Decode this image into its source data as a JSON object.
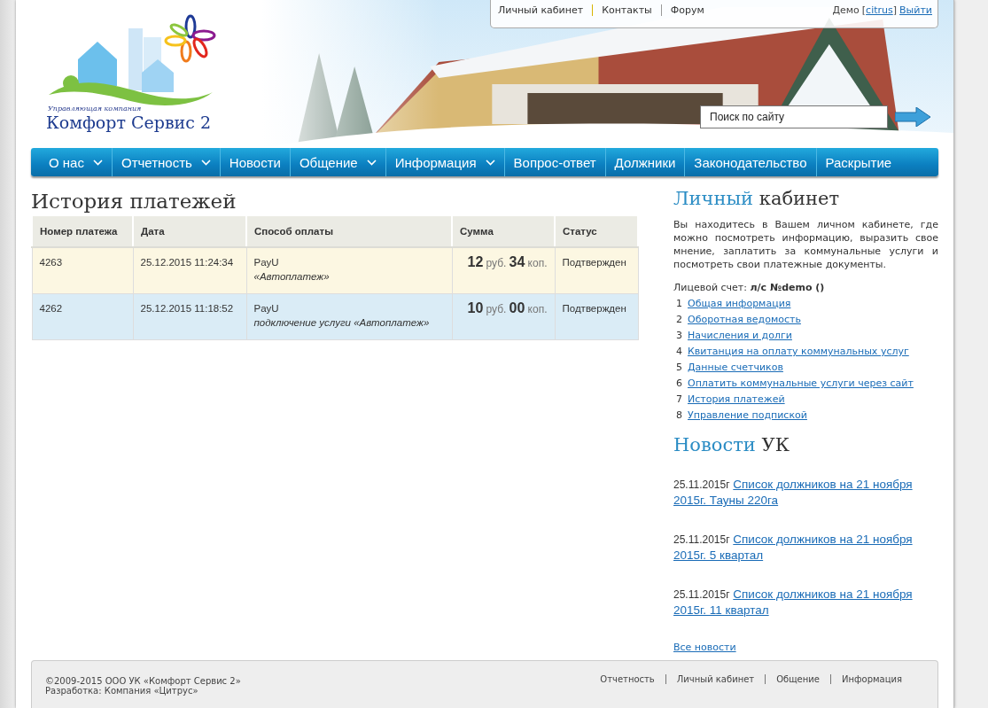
{
  "logo": {
    "tagline": "Управляющая компания",
    "name": "Комфорт Сервис 2"
  },
  "top_links": [
    {
      "label": "Личный кабинет"
    },
    {
      "label": "Контакты"
    },
    {
      "label": "Форум"
    }
  ],
  "user": {
    "name": "Демо",
    "open_bracket": "[",
    "login": "citrus",
    "close_bracket": "]",
    "logout": "Выйти"
  },
  "search": {
    "placeholder": "Поиск по сайту"
  },
  "nav": [
    {
      "label": "О нас",
      "dropdown": true
    },
    {
      "label": "Отчетность",
      "dropdown": true
    },
    {
      "label": "Новости",
      "dropdown": false
    },
    {
      "label": "Общение",
      "dropdown": true
    },
    {
      "label": "Информация",
      "dropdown": true
    },
    {
      "label": "Вопрос-ответ",
      "dropdown": false
    },
    {
      "label": "Должники",
      "dropdown": false
    },
    {
      "label": "Законодательство",
      "dropdown": false
    },
    {
      "label": "Раскрытие",
      "dropdown": false
    }
  ],
  "page_title": "История платежей",
  "table": {
    "columns": [
      "Номер платежа",
      "Дата",
      "Способ оплаты",
      "Сумма",
      "Статус"
    ],
    "rows": [
      {
        "number": "4263",
        "date": "25.12.2015 11:24:34",
        "method": "PayU",
        "method_note": "«Автоплатеж»",
        "rub": "12",
        "rub_unit": "руб.",
        "kop": "34",
        "kop_unit": "коп.",
        "status": "Подтвержден"
      },
      {
        "number": "4262",
        "date": "25.12.2015 11:18:52",
        "method": "PayU",
        "method_note": "подключение услуги «Автоплатеж»",
        "rub": "10",
        "rub_unit": "руб.",
        "kop": "00",
        "kop_unit": "коп.",
        "status": "Подтвержден"
      }
    ]
  },
  "cabinet": {
    "title_accent": "Личный",
    "title_rest": "кабинет",
    "intro": "Вы находитесь в Вашем личном кабинете, где можно посмотреть информацию, выразить свое мнение, заплатить за коммунальные услуги и посмотреть свои платежные документы.",
    "account": "Лицевой счет: **л/с №demo ()**",
    "links": [
      {
        "num": "1",
        "label": "Общая информация"
      },
      {
        "num": "2",
        "label": "Оборотная ведомость"
      },
      {
        "num": "3",
        "label": "Начисления и долги"
      },
      {
        "num": "4",
        "label": "Квитанция на оплату коммунальных услуг"
      },
      {
        "num": "5",
        "label": "Данные счетчиков"
      },
      {
        "num": "6",
        "label": "Оплатить коммунальные услуги через сайт"
      },
      {
        "num": "7",
        "label": "История платежей"
      },
      {
        "num": "8",
        "label": "Управление подпиской"
      }
    ]
  },
  "news": {
    "title_accent": "Новости",
    "title_rest": "УК",
    "items": [
      {
        "date": "25.11.2015г",
        "title": "Список должников на 21 ноября 2015г. Тауны 220га"
      },
      {
        "date": "25.11.2015г",
        "title": "Список должников на 21 ноября 2015г. 5 квартал"
      },
      {
        "date": "25.11.2015г",
        "title": "Список должников на 21 ноября 2015г. 11 квартал"
      }
    ],
    "all_link": "Все новости"
  },
  "footer": {
    "copyright": "©2009-2015 ООО УК «Комфорт Сервис 2»",
    "developer": "Разработка: Компания «Цитрус»",
    "links": [
      "Отчетность",
      "Личный кабинет",
      "Общение",
      "Информация"
    ]
  }
}
